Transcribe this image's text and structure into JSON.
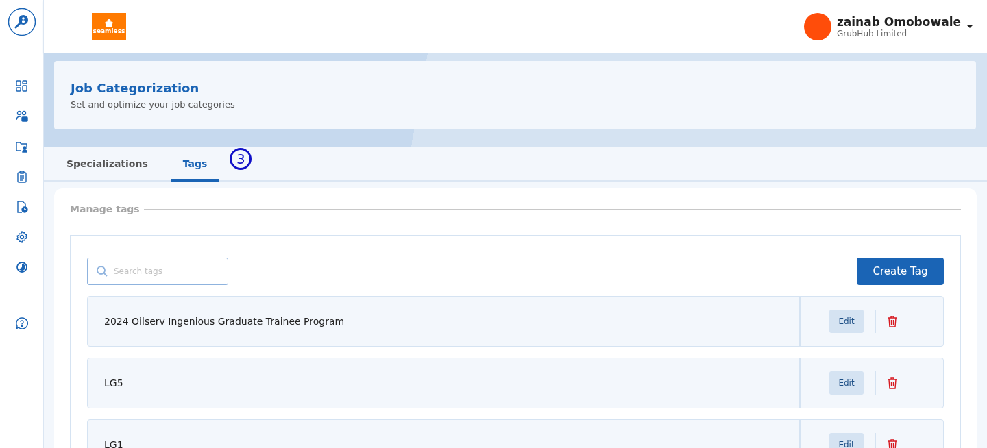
{
  "logo": {
    "text": "seamless"
  },
  "user": {
    "name": "zainab Omobowale",
    "company": "GrubHub Limited"
  },
  "header": {
    "title": "Job Categorization",
    "subtitle": "Set and optimize your job categories"
  },
  "tabs": [
    {
      "label": "Specializations",
      "selected": false
    },
    {
      "label": "Tags",
      "selected": true
    }
  ],
  "annotation": "3",
  "section": {
    "title": "Manage tags"
  },
  "search": {
    "placeholder": "Search tags"
  },
  "create_button": "Create Tag",
  "tags": [
    {
      "name": "2024 Oilserv Ingenious Graduate Trainee Program",
      "action": "Edit"
    },
    {
      "name": "LG5",
      "action": "Edit"
    },
    {
      "name": "LG1",
      "action": "Edit"
    }
  ]
}
